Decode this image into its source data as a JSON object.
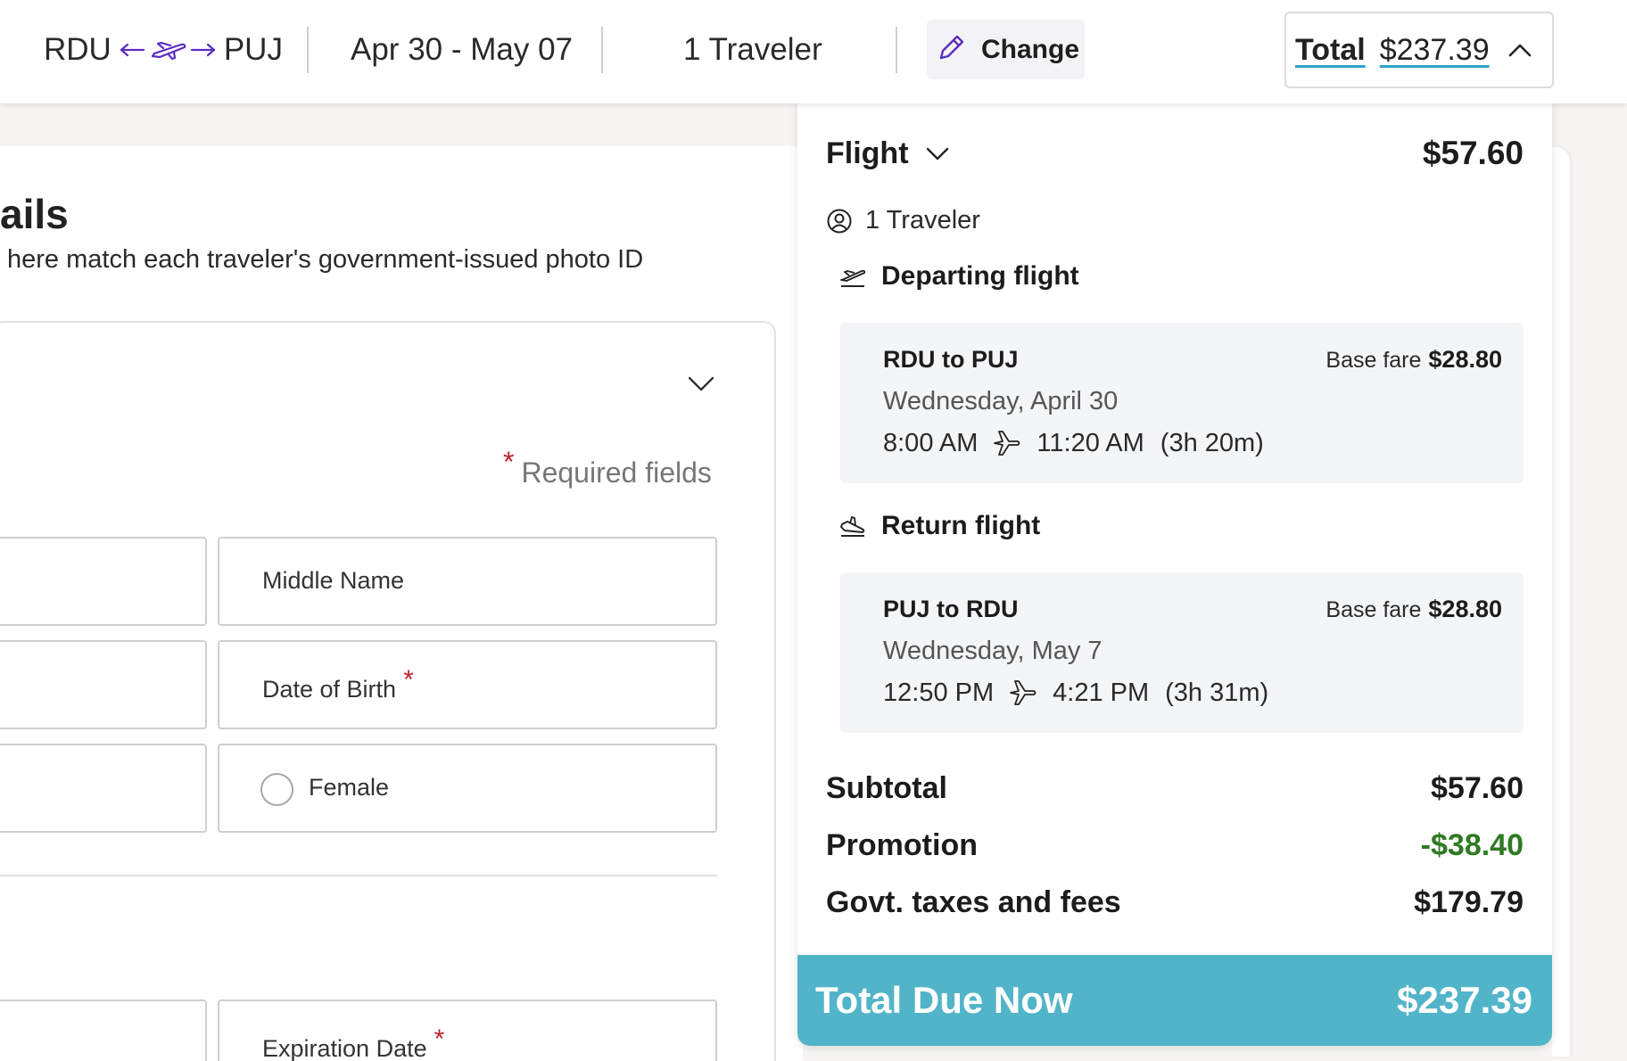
{
  "header": {
    "origin": "RDU",
    "destination": "PUJ",
    "dates": "Apr 30 - May 07",
    "travelers": "1 Traveler",
    "change_label": "Change",
    "total_label": "Total",
    "total_value": "$237.39"
  },
  "form": {
    "title": "ails",
    "subtitle": "here match each traveler's government-issued photo ID",
    "required_note": "Required fields",
    "required_star": "*",
    "fields": {
      "middle_name": "Middle Name",
      "date_of_birth": "Date of Birth",
      "female": "Female",
      "expiration_date": "Expiration Date"
    }
  },
  "summary": {
    "flight_label": "Flight",
    "flight_price": "$57.60",
    "travelers": "1 Traveler",
    "departing": {
      "title": "Departing flight",
      "route": "RDU to PUJ",
      "base_fare_label": "Base fare",
      "base_fare": "$28.80",
      "date": "Wednesday, April 30",
      "depart_time": "8:00 AM",
      "arrive_time": "11:20 AM",
      "duration": "(3h 20m)"
    },
    "returning": {
      "title": "Return flight",
      "route": "PUJ to RDU",
      "base_fare_label": "Base fare",
      "base_fare": "$28.80",
      "date": "Wednesday, May 7",
      "depart_time": "12:50 PM",
      "arrive_time": "4:21 PM",
      "duration": "(3h 31m)"
    },
    "subtotal_label": "Subtotal",
    "subtotal": "$57.60",
    "promotion_label": "Promotion",
    "promotion": "-$38.40",
    "taxes_label": "Govt. taxes and fees",
    "taxes": "$179.79",
    "total_due_label": "Total Due Now",
    "total_due": "$237.39"
  },
  "colors": {
    "accent": "#52b4c8",
    "promo": "#2f7a23",
    "required": "#c0232b",
    "brand_purple": "#5b2cc2"
  }
}
